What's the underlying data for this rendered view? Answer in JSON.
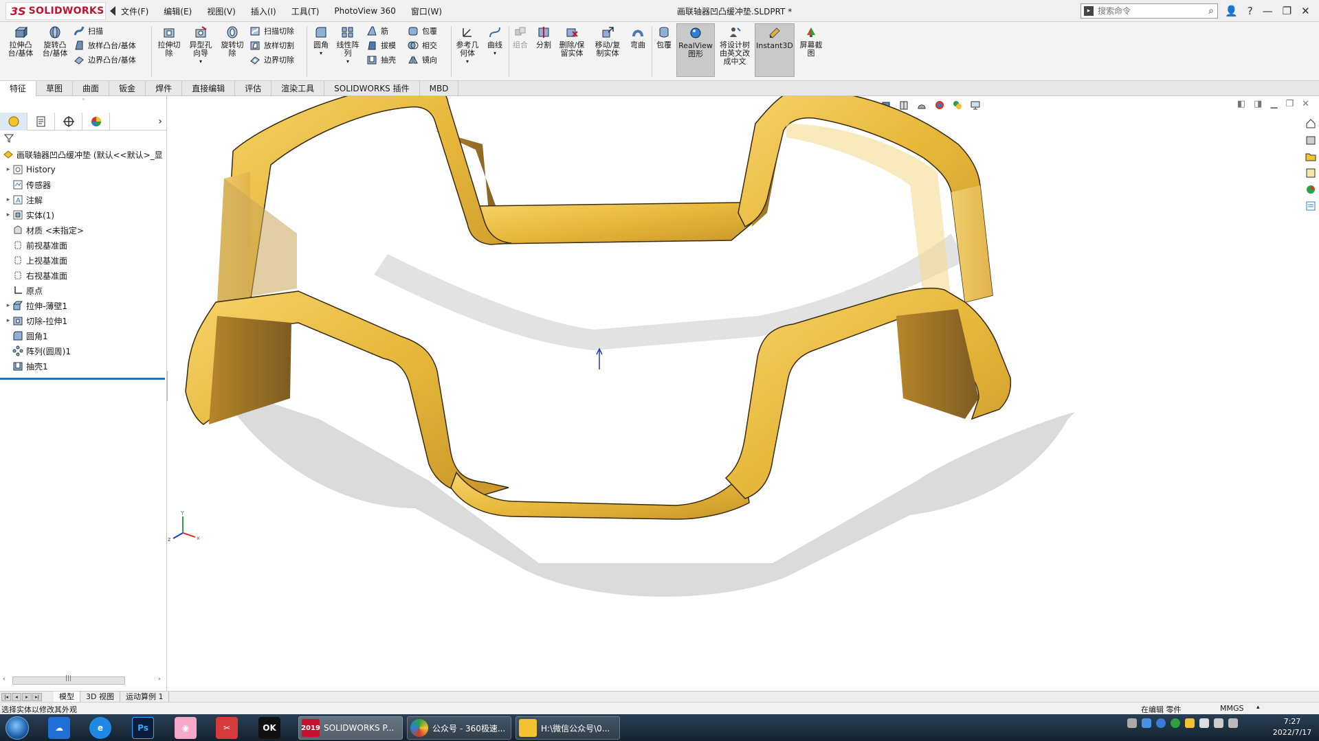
{
  "app": {
    "brand_prefix": "3S",
    "brand": "SOLIDWORKS",
    "doc_title": "画联轴器凹凸缓冲垫.SLDPRT *",
    "menu": [
      "文件(F)",
      "编辑(E)",
      "视图(V)",
      "插入(I)",
      "工具(T)",
      "PhotoView 360",
      "窗口(W)"
    ],
    "search_placeholder": "搜索命令"
  },
  "ribbon": {
    "big_buttons": [
      {
        "label": "拉伸凸\n台/基体"
      },
      {
        "label": "旋转凸\n台/基体"
      },
      {
        "label": "拉伸切\n除"
      },
      {
        "label": "异型孔\n向导"
      },
      {
        "label": "旋转切\n除"
      },
      {
        "label": "圆角"
      },
      {
        "label": "线性阵\n列"
      },
      {
        "label": "参考几\n何体"
      },
      {
        "label": "曲线"
      },
      {
        "label": "组合"
      },
      {
        "label": "分割"
      },
      {
        "label": "删除/保\n留实体"
      },
      {
        "label": "移动/复\n制实体"
      },
      {
        "label": "弯曲"
      },
      {
        "label": "包覆"
      },
      {
        "label": "RealView\n图形"
      },
      {
        "label": "将设计树\n由英文改\n成中文"
      },
      {
        "label": "Instant3D"
      },
      {
        "label": "屏幕截\n图"
      }
    ],
    "small_buttons": [
      {
        "label": "扫描"
      },
      {
        "label": "放样凸台/基体"
      },
      {
        "label": "边界凸台/基体"
      },
      {
        "label": "扫描切除"
      },
      {
        "label": "放样切割"
      },
      {
        "label": "边界切除"
      },
      {
        "label": "筋"
      },
      {
        "label": "拔模"
      },
      {
        "label": "抽壳"
      },
      {
        "label": "包覆"
      },
      {
        "label": "相交"
      },
      {
        "label": "镜向"
      }
    ]
  },
  "tabs": [
    "特征",
    "草图",
    "曲面",
    "钣金",
    "焊件",
    "直接编辑",
    "评估",
    "渲染工具",
    "SOLIDWORKS 插件",
    "MBD"
  ],
  "tree": {
    "root": "画联轴器凹凸缓冲垫  (默认<<默认>_显",
    "items": [
      {
        "label": "History",
        "expandable": true,
        "icon": "history-icon"
      },
      {
        "label": "传感器",
        "expandable": false,
        "icon": "sensor-icon"
      },
      {
        "label": "注解",
        "expandable": true,
        "icon": "annotation-icon"
      },
      {
        "label": "实体(1)",
        "expandable": true,
        "icon": "solid-body-icon"
      },
      {
        "label": "材质 <未指定>",
        "expandable": false,
        "icon": "material-icon"
      },
      {
        "label": "前视基准面",
        "expandable": false,
        "icon": "plane-icon"
      },
      {
        "label": "上视基准面",
        "expandable": false,
        "icon": "plane-icon"
      },
      {
        "label": "右视基准面",
        "expandable": false,
        "icon": "plane-icon"
      },
      {
        "label": "原点",
        "expandable": false,
        "icon": "origin-icon"
      },
      {
        "label": "拉伸-薄壁1",
        "expandable": true,
        "icon": "extrude-icon"
      },
      {
        "label": "切除-拉伸1",
        "expandable": true,
        "icon": "cut-extrude-icon"
      },
      {
        "label": "圆角1",
        "expandable": false,
        "icon": "fillet-icon"
      },
      {
        "label": "阵列(圆周)1",
        "expandable": false,
        "icon": "circular-pattern-icon"
      },
      {
        "label": "抽壳1",
        "expandable": false,
        "icon": "shell-icon"
      }
    ]
  },
  "triad": {
    "x": "x",
    "y": "Y",
    "z": "z"
  },
  "bottom_tabs": [
    "模型",
    "3D 视图",
    "运动算例 1"
  ],
  "status": {
    "left": "选择实体以修改其外观",
    "mode": "在编辑 零件",
    "units": "MMGS"
  },
  "taskbar": {
    "tasks": [
      "SOLIDWORKS P...",
      "公众号 - 360极速...",
      "H:\\微信公众号\\0..."
    ],
    "sw_badge": "2019",
    "ps_label": "Ps",
    "ok_label": "OK",
    "time": "7:27",
    "date": "2022/7/17"
  },
  "colors": {
    "model_gold": "#e6b83a",
    "model_shadow": "#bdbdbd",
    "brand_red": "#c8102e"
  }
}
